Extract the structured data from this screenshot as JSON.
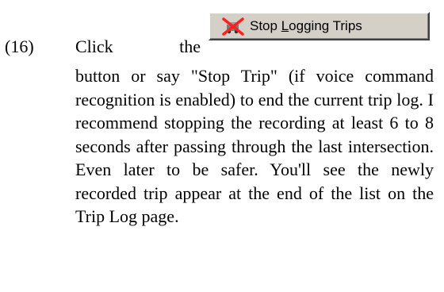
{
  "step": {
    "number": "(16)",
    "click_word": "Click",
    "the_word": "the"
  },
  "button": {
    "label_before": "Stop ",
    "label_accel": "L",
    "label_after": "ogging Trips",
    "icon": "stop-trip-icon",
    "colors": {
      "face": "#d4d0c8",
      "icon_x": "#ff2020"
    }
  },
  "body": {
    "text": "button or say \"Stop Trip\" (if  voice command recognition is enabled) to end the current trip log.  I recommend stopping the recording at least 6 to 8 seconds after passing through the last intersection.  Even later to be safer. You'll see the newly recorded trip appear at the end of the list on the Trip Log page."
  }
}
